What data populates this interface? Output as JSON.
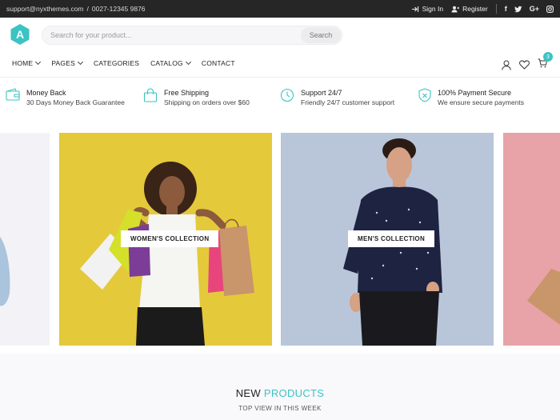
{
  "topbar": {
    "email": "support@nyxthemes.com",
    "divider": "/",
    "phone": "0027-12345 9876",
    "signin_label": "Sign In",
    "register_label": "Register",
    "social": [
      "f",
      "t",
      "G+",
      "ig"
    ]
  },
  "header": {
    "logo_letter": "A",
    "search_placeholder": "Search for your product...",
    "search_button": "Search"
  },
  "nav": {
    "items": [
      {
        "label": "HOME",
        "dropdown": true
      },
      {
        "label": "PAGES",
        "dropdown": true
      },
      {
        "label": "CATEGORIES",
        "dropdown": false
      },
      {
        "label": "CATALOG",
        "dropdown": true
      },
      {
        "label": "CONTACT",
        "dropdown": false
      }
    ],
    "cart_count": "3"
  },
  "features": [
    {
      "title": "Money Back",
      "subtitle": "30 Days Money Back Guarantee",
      "icon": "wallet-icon"
    },
    {
      "title": "Free Shipping",
      "subtitle": "Shipping on orders over $60",
      "icon": "shopping-bag-icon"
    },
    {
      "title": "Support 24/7",
      "subtitle": "Friendly 24/7 customer support",
      "icon": "clock-icon"
    },
    {
      "title": "100% Payment Secure",
      "subtitle": "We ensure secure payments",
      "icon": "shield-icon"
    }
  ],
  "banners": [
    {
      "label": "WOMEN'S COLLECTION",
      "bg": "#e4c93b"
    },
    {
      "label": "MEN'S COLLECTION",
      "bg": "#b9c6da"
    }
  ],
  "section": {
    "title_prefix": "NEW",
    "title_accent": "PRODUCTS",
    "subtitle": "TOP VIEW IN THIS WEEK"
  },
  "colors": {
    "accent": "#3cc3c3",
    "topbar": "#262626"
  }
}
